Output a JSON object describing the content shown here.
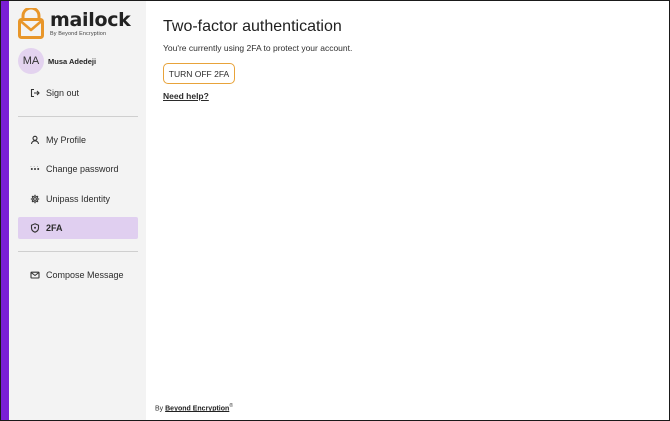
{
  "brand": {
    "name": "mailock",
    "tagline": "By Beyond Encryption",
    "accent_color": "#7a1fd6",
    "logo_color": "#e8962a"
  },
  "user": {
    "initials": "MA",
    "name": "Musa Adedeji"
  },
  "sidebar": {
    "sign_out": {
      "label": "Sign out",
      "icon": "sign-out-icon"
    },
    "items": [
      {
        "label": "My Profile",
        "icon": "user-icon"
      },
      {
        "label": "Change password",
        "icon": "password-dots-icon"
      },
      {
        "label": "Unipass Identity",
        "icon": "gear-icon"
      },
      {
        "label": "2FA",
        "icon": "shield-icon",
        "active": true
      },
      {
        "label": "Compose Message",
        "icon": "mail-icon"
      }
    ],
    "active_bg": "#e0cff0"
  },
  "main": {
    "title": "Two-factor authentication",
    "description": "You're currently using 2FA to protect your account.",
    "turn_off_label": "TURN OFF 2FA",
    "help_label": "Need help?",
    "button_border_color": "#e8a33a"
  },
  "footer": {
    "prefix": "By",
    "link": "Beyond Encryption",
    "mark": "®"
  }
}
